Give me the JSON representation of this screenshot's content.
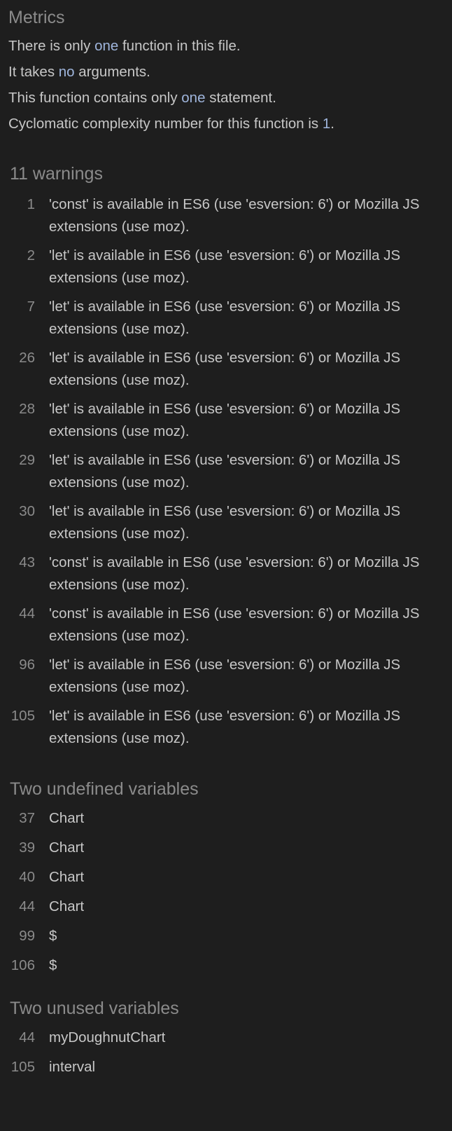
{
  "metrics": {
    "title": "Metrics",
    "line1": {
      "pre": "There is only ",
      "hl": "one",
      "post": " function in this file."
    },
    "line2": {
      "pre": "It takes ",
      "hl": "no",
      "post": " arguments."
    },
    "line3": {
      "pre": "This function contains only ",
      "hl": "one",
      "post": " statement."
    },
    "line4": {
      "pre": "Cyclomatic complexity number for this function is ",
      "hl": "1",
      "post": "."
    }
  },
  "warnings": {
    "title": "11 warnings",
    "items": [
      {
        "line": "1",
        "text": "'const' is available in ES6 (use 'esversion: 6') or Mozilla JS extensions (use moz)."
      },
      {
        "line": "2",
        "text": "'let' is available in ES6 (use 'esversion: 6') or Mozilla JS extensions (use moz)."
      },
      {
        "line": "7",
        "text": "'let' is available in ES6 (use 'esversion: 6') or Mozilla JS extensions (use moz)."
      },
      {
        "line": "26",
        "text": "'let' is available in ES6 (use 'esversion: 6') or Mozilla JS extensions (use moz)."
      },
      {
        "line": "28",
        "text": "'let' is available in ES6 (use 'esversion: 6') or Mozilla JS extensions (use moz)."
      },
      {
        "line": "29",
        "text": "'let' is available in ES6 (use 'esversion: 6') or Mozilla JS extensions (use moz)."
      },
      {
        "line": "30",
        "text": "'let' is available in ES6 (use 'esversion: 6') or Mozilla JS extensions (use moz)."
      },
      {
        "line": "43",
        "text": "'const' is available in ES6 (use 'esversion: 6') or Mozilla JS extensions (use moz)."
      },
      {
        "line": "44",
        "text": "'const' is available in ES6 (use 'esversion: 6') or Mozilla JS extensions (use moz)."
      },
      {
        "line": "96",
        "text": "'let' is available in ES6 (use 'esversion: 6') or Mozilla JS extensions (use moz)."
      },
      {
        "line": "105",
        "text": "'let' is available in ES6 (use 'esversion: 6') or Mozilla JS extensions (use moz)."
      }
    ]
  },
  "undefined_vars": {
    "title": "Two undefined variables",
    "items": [
      {
        "line": "37",
        "name": "Chart"
      },
      {
        "line": "39",
        "name": "Chart"
      },
      {
        "line": "40",
        "name": "Chart"
      },
      {
        "line": "44",
        "name": "Chart"
      },
      {
        "line": "99",
        "name": "$"
      },
      {
        "line": "106",
        "name": "$"
      }
    ]
  },
  "unused_vars": {
    "title": "Two unused variables",
    "items": [
      {
        "line": "44",
        "name": "myDoughnutChart"
      },
      {
        "line": "105",
        "name": "interval"
      }
    ]
  },
  "colors": {
    "background": "#1e1e1e",
    "text": "#c7c7c7",
    "muted": "#8b8b8b",
    "highlight": "#9fb5dc"
  }
}
